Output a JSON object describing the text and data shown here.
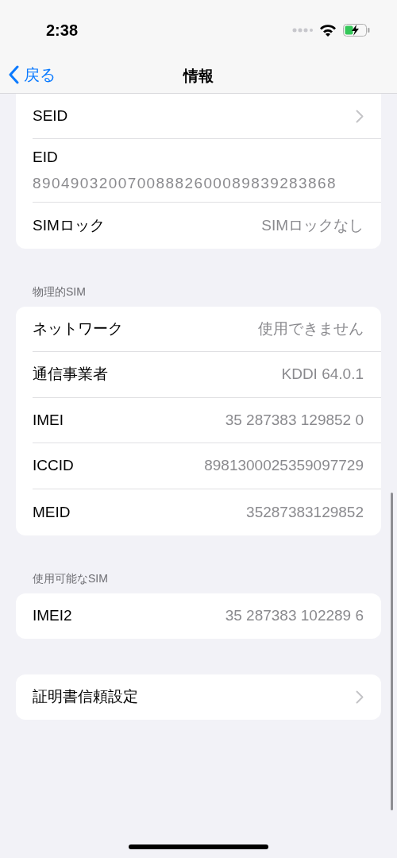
{
  "status_bar": {
    "time": "2:38"
  },
  "nav": {
    "back": "戻る",
    "title": "情報"
  },
  "groups": [
    {
      "rows": [
        {
          "kind": "chevron",
          "label": "SEID"
        },
        {
          "kind": "subtitle",
          "label": "EID",
          "value": "89049032007008882600089839283868"
        },
        {
          "kind": "value",
          "label": "SIMロック",
          "value": "SIMロックなし"
        }
      ]
    },
    {
      "header": "物理的SIM",
      "rows": [
        {
          "kind": "value",
          "label": "ネットワーク",
          "value": "使用できません"
        },
        {
          "kind": "value",
          "label": "通信事業者",
          "value": "KDDI 64.0.1"
        },
        {
          "kind": "value",
          "label": "IMEI",
          "value": "35 287383 129852 0"
        },
        {
          "kind": "value",
          "label": "ICCID",
          "value": "8981300025359097729"
        },
        {
          "kind": "value",
          "label": "MEID",
          "value": "35287383129852"
        }
      ]
    },
    {
      "header": "使用可能なSIM",
      "rows": [
        {
          "kind": "value",
          "label": "IMEI2",
          "value": "35 287383 102289 6"
        }
      ]
    },
    {
      "rows": [
        {
          "kind": "chevron",
          "label": "証明書信頼設定"
        }
      ]
    }
  ]
}
